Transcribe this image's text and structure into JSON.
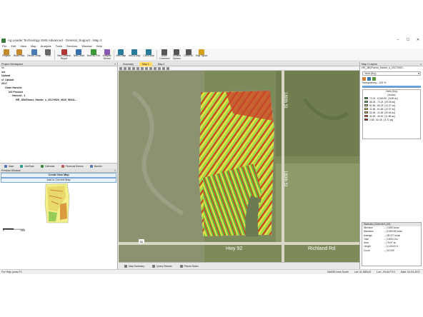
{
  "window": {
    "title": "Ag Leader Technology SMS Advanced - General_Support - Map 2",
    "controls": [
      "–",
      "☐",
      "✕"
    ]
  },
  "menu": [
    "File",
    "Edit",
    "View",
    "Map",
    "Analysis",
    "Tools",
    "Services",
    "Window",
    "Help"
  ],
  "toolbar": [
    {
      "label": "Projects",
      "icon": "projects-icon",
      "color": "#c58a2b"
    },
    {
      "label": "Read Files",
      "icon": "read-files-icon",
      "color": "#c58a2b"
    },
    {
      "label": "Device Setup",
      "icon": "device-setup-icon",
      "color": "#4a7bb5"
    },
    {
      "label": "Print",
      "icon": "print-icon",
      "color": "#666666"
    },
    {
      "label": "New General\nReport",
      "icon": "report-icon",
      "color": "#b03a3a"
    },
    {
      "label": "New Chart",
      "icon": "chart-icon",
      "color": "#3a70b0"
    },
    {
      "label": "New 3D Plot",
      "icon": "plot3d-icon",
      "color": "#3a9a3a"
    },
    {
      "label": "Analysis\nWizard",
      "icon": "wizard-icon",
      "color": "#8a5ab0"
    },
    {
      "label": "New Map",
      "icon": "new-map-icon",
      "color": "#2a7a9a"
    },
    {
      "label": "Add to Map",
      "icon": "add-map-icon",
      "color": "#2a7a9a"
    },
    {
      "label": "Close Map",
      "icon": "close-map-icon",
      "color": "#2a7a9a"
    },
    {
      "label": "Batch\nCommand",
      "icon": "batch-icon",
      "color": "#555555"
    },
    {
      "label": "General\nOptions",
      "icon": "options-icon",
      "color": "#555555"
    },
    {
      "label": "Close All",
      "icon": "close-all-icon",
      "color": "#555555"
    },
    {
      "label": "Help Topics",
      "icon": "help-icon",
      "color": "#d4a020"
    }
  ],
  "left_pane": {
    "header": "Project Workspace",
    "tree": [
      {
        "text": "",
        "bold": false,
        "indent": 0
      },
      {
        "text": "ns",
        "bold": false,
        "indent": 0
      },
      {
        "text": "ool",
        "bold": true,
        "indent": 0
      },
      {
        "text": "",
        "bold": false,
        "indent": 0
      },
      {
        "text": "Upload",
        "bold": true,
        "indent": 0
      },
      {
        "text": "ct_Upload",
        "bold": true,
        "indent": 0
      },
      {
        "text": "2017",
        "bold": true,
        "indent": 0
      },
      {
        "text": "Grain Harvest",
        "bold": true,
        "indent": 1
      },
      {
        "text": "NO Product",
        "bold": true,
        "indent": 2
      },
      {
        "text": "Harvest - 1",
        "bold": true,
        "indent": 3
      },
      {
        "text": "HR_JBGFarms_Harder_s_20170920_0620_56641...",
        "bold": true,
        "indent": 4
      }
    ],
    "tabs": [
      {
        "label": "Main",
        "color": "#4a7bb5"
      },
      {
        "label": "Job/Task",
        "color": "#2a9a8a"
      },
      {
        "label": "Calendar",
        "color": "#3a8a3a"
      },
      {
        "label": "Financial Entries",
        "color": "#c05a5a"
      },
      {
        "label": "Monitor",
        "color": "#5a7ab0"
      }
    ]
  },
  "preview": {
    "header": "Preview Window",
    "create_btn": "Create New Map",
    "add_btn": "Add to Current Map",
    "scale_start": "0",
    "scale_end": "750ft"
  },
  "map_tabs": [
    {
      "label": "Summary",
      "active": false
    },
    {
      "label": "Map 1",
      "active": true
    },
    {
      "label": "Map 2",
      "active": false
    }
  ],
  "map_labels": {
    "road_vertical": "180th St",
    "road_bottom": "Hwy 92",
    "road_right": "Richland Rd",
    "route_shield": "92"
  },
  "bottom_tabs": [
    "Map Summary",
    "Query Results",
    "Picture Notes"
  ],
  "right_pane": {
    "header": "Map 2 Layers",
    "layer": "HR_JBGFarms_Harder_s_20170920...",
    "attribute_select": "Yield (Dry)",
    "transparency": "Transparency - 100 %",
    "legend_title": "Yield (Dry)",
    "legend_unit": "(bu/ac)",
    "legend": [
      {
        "range": "73.24 - 5,369.59",
        "pct": "[ 8.69 ac]",
        "color": "#1a9a2a"
      },
      {
        "range": "66.25 - 73.24",
        "pct": "[29.05 ac]",
        "color": "#5ac84a"
      },
      {
        "range": "61.66 - 66.25",
        "pct": "[12.37 ac]",
        "color": "#a8e050"
      },
      {
        "range": "41.66 - 61.66",
        "pct": "[12.37 ac]",
        "color": "#f0f040"
      },
      {
        "range": "32.45 - 41.66",
        "pct": "[20.65 ac]",
        "color": "#f0a030"
      },
      {
        "range": "32.45 - 49.92",
        "pct": "[11.89 ac]",
        "color": "#e05020"
      },
      {
        "range": "2.68 - 32.45",
        "pct": "[ 5.71 ac]",
        "color": "#c01010"
      }
    ],
    "stats_header": "Statistics (Selected | All)",
    "stats": [
      {
        "k": "Minimum",
        "v": "-- | 2.680 bu/ac"
      },
      {
        "k": "Maximum",
        "v": "-- | 5,369.59 bu/ac"
      },
      {
        "k": "Average",
        "v": "-- | 59.227 bu/ac"
      },
      {
        "k": "Total",
        "v": "-- | 4,505.1 bu"
      },
      {
        "k": "Area",
        "v": "-- | 75.67 ac"
      },
      {
        "k": "Length",
        "v": "-- | 4,125.61 ft"
      },
      {
        "k": "Count",
        "v": "-- | 10,039"
      }
    ]
  },
  "statusbar": {
    "left": "For Help, press F1",
    "coords": [
      "NAD83 Iowa South",
      "Lat: 41.268143",
      "Lon: -93.647713",
      "Date: 04-04-2017"
    ]
  }
}
